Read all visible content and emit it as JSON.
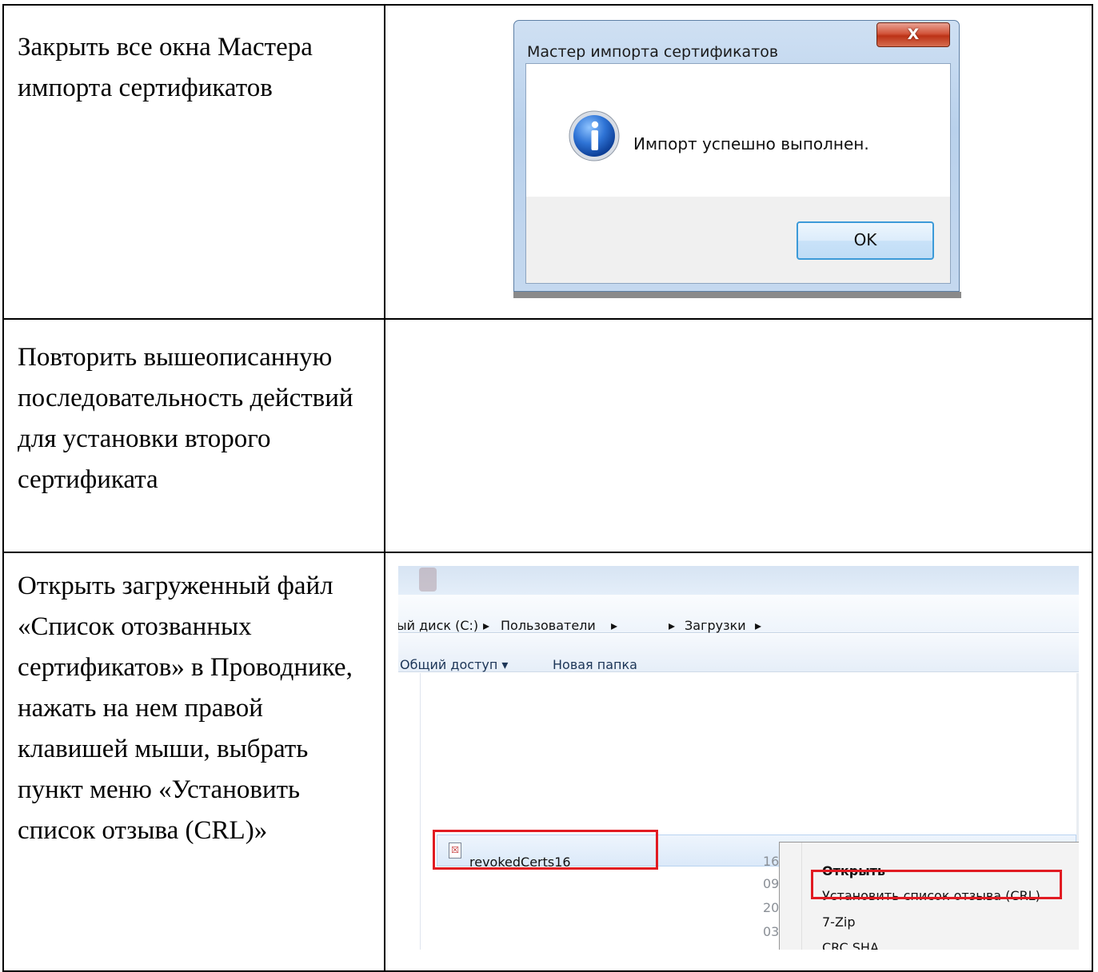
{
  "rows": [
    {
      "instruction": "Закрыть все окна Мастера импорта сертификатов",
      "dialog": {
        "title": "Мастер импорта сертификатов",
        "close_label": "X",
        "message": "Импорт успешно выполнен.",
        "ok_label": "OK"
      }
    },
    {
      "instruction": "Повторить вышеописанную последовательность действий для установки второго сертификата"
    },
    {
      "instruction": "Открыть загруженный файл «Список отозванных сертификатов» в Проводнике, нажать на нем правой клавишей мыши, выбрать пункт меню «Установить список отзыва (CRL)»",
      "explorer": {
        "breadcrumbs": [
          "ый диск (C:)",
          "Пользователи",
          "Загрузки"
        ],
        "toolbar": {
          "share_label": "Общий доступ",
          "new_folder_label": "Новая папка"
        },
        "file_name": "revokedCerts16",
        "date_fragments": [
          "16",
          "09",
          "20",
          "03"
        ],
        "context_menu": {
          "items": [
            "Открыть",
            "Установить список отзыва (CRL)",
            "7-Zip",
            "CRC SHA"
          ]
        }
      }
    }
  ]
}
